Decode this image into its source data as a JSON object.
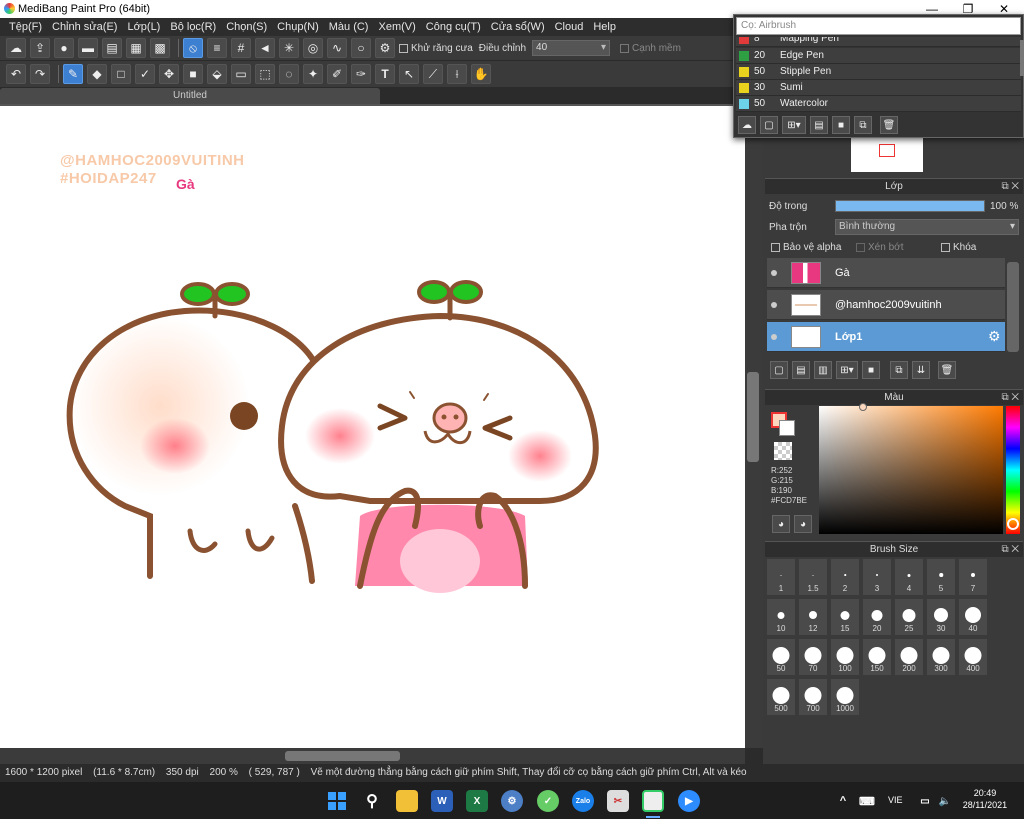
{
  "window": {
    "title": "MediBang Paint Pro (64bit)",
    "min": "—",
    "max": "❐",
    "close": "✕"
  },
  "menu": [
    "Tệp(F)",
    "Chỉnh sửa(E)",
    "Lớp(L)",
    "Bộ lọc(R)",
    "Chọn(S)",
    "Chụp(N)",
    "Màu (C)",
    "Xem(V)",
    "Công cụ(T)",
    "Cửa sổ(W)",
    "Cloud",
    "Help"
  ],
  "toolbar": {
    "antialias_label": "Khử răng cưa",
    "adjust_label": "Điều chỉnh",
    "adjust_value": "40",
    "smooth_label": "Cạnh mềm"
  },
  "doc_tab": "Untitled",
  "canvas": {
    "watermark1": "@HAMHOC2009VUITINH",
    "watermark2": "#HOIDAP247",
    "tag": "Gà"
  },
  "brush_popup": {
    "search_placeholder": "Cọ: Airbrush",
    "brushes": [
      {
        "size": "8",
        "name": "Mapping Pen",
        "color": "#e03a3a"
      },
      {
        "size": "20",
        "name": "Edge Pen",
        "color": "#2ea043"
      },
      {
        "size": "50",
        "name": "Stipple Pen",
        "color": "#e8d21e"
      },
      {
        "size": "30",
        "name": "Sumi",
        "color": "#e8d21e"
      },
      {
        "size": "50",
        "name": "Watercolor",
        "color": "#6cd3e8"
      }
    ]
  },
  "layer_panel": {
    "title": "Lớp",
    "opacity_label": "Độ trong",
    "opacity_value": "100 %",
    "opacity": 1.0,
    "blend_label": "Pha trộn",
    "blend_value": "Bình thường",
    "protect_alpha": "Bảo vệ alpha",
    "clipping": "Xén bớt",
    "lock": "Khóa",
    "layers": [
      {
        "name": "Gà"
      },
      {
        "name": "@hamhoc2009vuitinh"
      },
      {
        "name": "Lớp1"
      }
    ]
  },
  "color_panel": {
    "title": "Màu",
    "r": "R:252",
    "g": "G:215",
    "b": "B:190",
    "hex": "#FCD7BE",
    "current": "#FCD7BE"
  },
  "brush_size_panel": {
    "title": "Brush Size",
    "sizes": [
      "1",
      "1.5",
      "2",
      "3",
      "4",
      "5",
      "7",
      "10",
      "12",
      "15",
      "20",
      "25",
      "30",
      "40",
      "50",
      "70",
      "100",
      "150",
      "200",
      "300",
      "400",
      "500",
      "700",
      "1000"
    ]
  },
  "status": {
    "dims": "1600 * 1200 pixel",
    "cm": "(11.6 * 8.7cm)",
    "dpi": "350 dpi",
    "zoom": "200 %",
    "coord": "( 529, 787 )",
    "hint": "Vẽ một đường thẳng bằng cách giữ phím Shift, Thay đổi cỡ cọ bằng cách giữ phím Ctrl, Alt và kéo"
  },
  "tray": {
    "lang": "VIE",
    "time": "20:49",
    "date": "28/11/2021"
  }
}
